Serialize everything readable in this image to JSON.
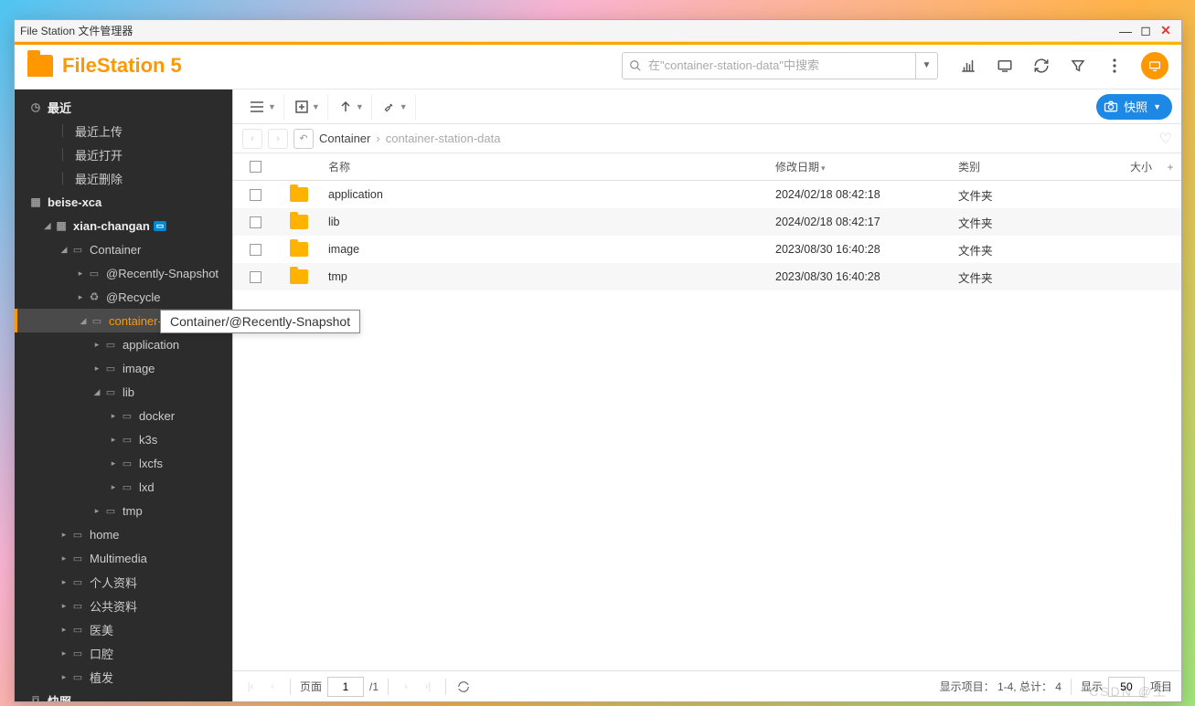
{
  "window": {
    "title": "File Station 文件管理器"
  },
  "app": {
    "name": "FileStation 5"
  },
  "search": {
    "placeholder": "在\"container-station-data\"中搜索"
  },
  "sidebar": {
    "recent": {
      "label": "最近",
      "upload": "最近上传",
      "open": "最近打开",
      "delete": "最近删除"
    },
    "nas": "beise-xca",
    "volume": "xian-changan",
    "tree": {
      "container": "Container",
      "recently_snapshot": "@Recently-Snapshot",
      "recycle": "@Recycle",
      "csd": "container-station-data",
      "application": "application",
      "image": "image",
      "lib": "lib",
      "docker": "docker",
      "k3s": "k3s",
      "lxcfs": "lxcfs",
      "lxd": "lxd",
      "tmp": "tmp",
      "home": "home",
      "multimedia": "Multimedia",
      "personal": "个人资料",
      "public": "公共资料",
      "medical": "医美",
      "dental": "口腔",
      "hair": "植发",
      "snapshot": "快照"
    }
  },
  "toolbar": {
    "snapshot": "快照"
  },
  "breadcrumb": {
    "c1": "Container",
    "c2": "container-station-data"
  },
  "columns": {
    "name": "名称",
    "date": "修改日期",
    "type": "类别",
    "size": "大小"
  },
  "rows": [
    {
      "name": "application",
      "date": "2024/02/18 08:42:18",
      "type": "文件夹"
    },
    {
      "name": "lib",
      "date": "2024/02/18 08:42:17",
      "type": "文件夹"
    },
    {
      "name": "image",
      "date": "2023/08/30 16:40:28",
      "type": "文件夹"
    },
    {
      "name": "tmp",
      "date": "2023/08/30 16:40:28",
      "type": "文件夹"
    }
  ],
  "tooltip": "Container/@Recently-Snapshot",
  "footer": {
    "page_label": "页面",
    "page": "1",
    "total_pages": "/1",
    "summary": "显示项目： 1-4, 总计： 4",
    "show_label": "显示",
    "show_value": "50",
    "item_label": "项目"
  }
}
